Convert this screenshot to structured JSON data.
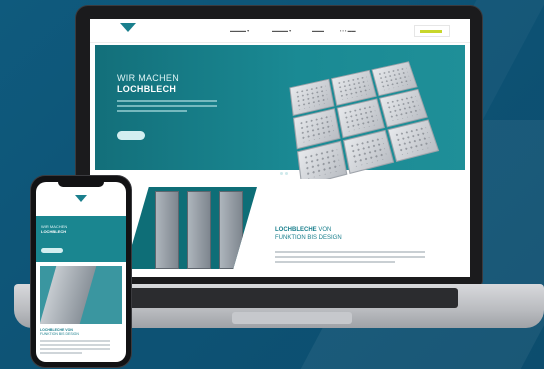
{
  "colors": {
    "background": "#0e5577",
    "brand_teal": "#1a7f8d",
    "accent_lime": "#c8d62b",
    "laptop_bezel": "#1b1b1d",
    "laptop_base": "#c6c8cc"
  },
  "laptop_site": {
    "hero": {
      "title_line1": "WIR MACHEN",
      "title_line2": "LOCHBLECH"
    },
    "section2": {
      "title_bold": "LOCHBLECHE",
      "title_light": "VON",
      "subtitle": "FUNKTION BIS DESIGN"
    }
  },
  "phone_site": {
    "hero": {
      "title_line1": "WIR MACHEN",
      "title_line2": "LOCHBLECH"
    },
    "section2": {
      "title": "LOCHBLECHE VON",
      "subtitle": "FUNKTION BIS DESIGN"
    }
  },
  "icons": [
    "logo-triangle-icon",
    "carousel-dots-icon"
  ]
}
